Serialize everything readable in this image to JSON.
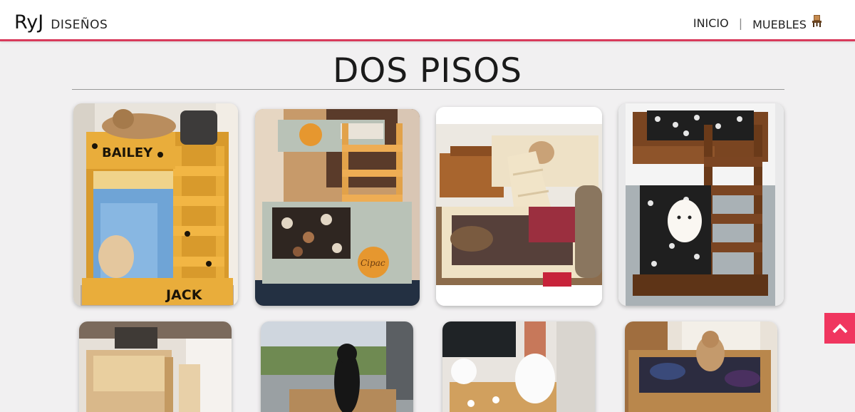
{
  "header": {
    "brand_name": "RyJ",
    "brand_sub": "DISEÑOS",
    "nav": [
      {
        "label": "INICIO"
      },
      {
        "separator": "|"
      },
      {
        "label": "MUEBLES"
      }
    ],
    "accent_color": "#d83a5b"
  },
  "page": {
    "title": "DOS PISOS"
  },
  "gallery": {
    "photos": [
      {
        "subject": "wooden-bunk-bed-bailey-jack",
        "painted_names": [
          "BAILEY",
          "JACK"
        ]
      },
      {
        "subject": "gray-bunk-bed-with-paw",
        "painted_name": "Cipac"
      },
      {
        "subject": "natural-wood-bunk-ramp-pug"
      },
      {
        "subject": "dark-wood-bunk-white-dog"
      },
      {
        "subject": "light-wood-bunk-bed"
      },
      {
        "subject": "black-dog-at-window"
      },
      {
        "subject": "white-dogs-tv-room"
      },
      {
        "subject": "wooden-bed-small-dog"
      }
    ]
  },
  "scroll_top": {
    "icon": "chevron-up-icon",
    "color": "#f0365f"
  }
}
